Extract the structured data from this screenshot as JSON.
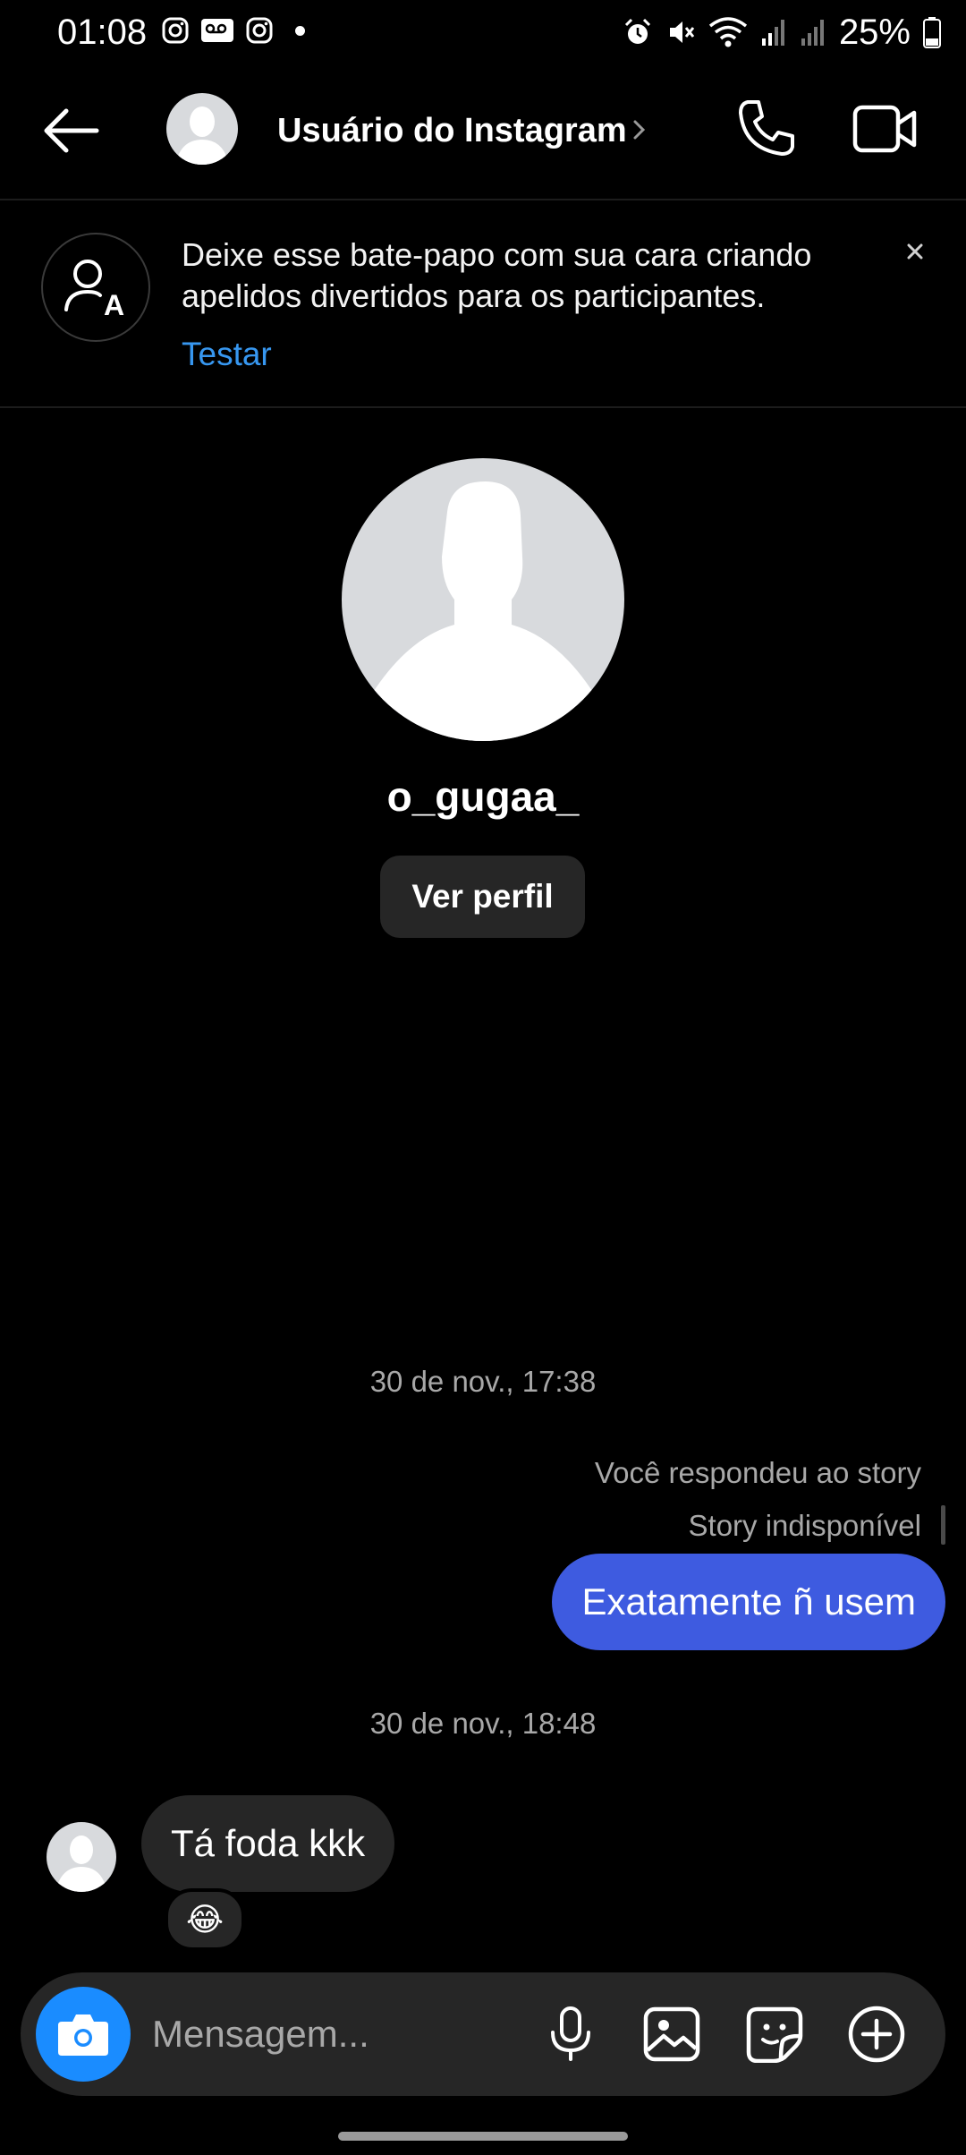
{
  "status_bar": {
    "time": "01:08",
    "battery": "25%",
    "left_icons": [
      "instagram-icon",
      "voicemail-icon",
      "instagram-icon",
      "dot-icon"
    ],
    "right_icons": [
      "alarm-icon",
      "mute-icon",
      "wifi-icon",
      "signal-icon",
      "signal-icon",
      "battery-icon"
    ]
  },
  "header": {
    "title": "Usuário do Instagram",
    "icons": [
      "back-arrow-icon",
      "chevron-right-icon",
      "phone-icon",
      "video-camera-icon"
    ]
  },
  "banner": {
    "text": "Deixe esse bate-papo com sua cara criando apelidos divertidos para os participantes.",
    "action": "Testar",
    "icon": "nickname-icon",
    "close_icon": "close-icon"
  },
  "profile": {
    "username": "o_gugaa_",
    "button": "Ver perfil"
  },
  "messages": {
    "ts1": "30 de nov., 17:38",
    "reply_note": "Você respondeu ao story",
    "story_status": "Story indisponível",
    "sent_text": "Exatamente ñ usem",
    "ts2": "30 de nov., 18:48",
    "received_text": "Tá foda kkk",
    "reaction": "😂"
  },
  "composer": {
    "placeholder": "Mensagem...",
    "icons": [
      "camera-icon",
      "microphone-icon",
      "gallery-icon",
      "sticker-icon",
      "plus-circle-icon"
    ]
  },
  "colors": {
    "background": "#000000",
    "accent_blue": "#3797f0",
    "sent_bubble": "#3e5be0",
    "received_bubble": "#262626",
    "camera_button": "#1a8cff"
  }
}
